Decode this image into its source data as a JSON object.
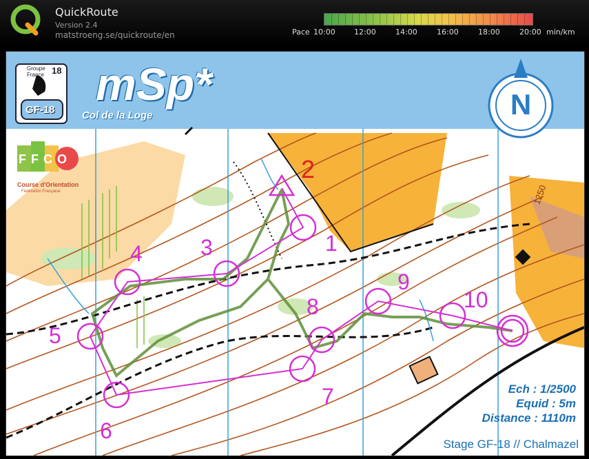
{
  "app": {
    "name": "QuickRoute",
    "version": "Version 2.4",
    "url": "matstroeng.se/quickroute/en"
  },
  "pace": {
    "prefix": "Pace",
    "ticks": [
      "10:00",
      "12:00",
      "14:00",
      "16:00",
      "18:00",
      "20:00"
    ],
    "unit": "min/km",
    "colors": [
      "#4aa64a",
      "#8fc34a",
      "#d8d84a",
      "#f2c24a",
      "#f08a4a",
      "#e84a4a"
    ]
  },
  "map": {
    "title": "mSp*",
    "subtitle": "Col de la Loge",
    "north_letter": "N",
    "logo_badge": {
      "line1": "Groupe",
      "line2": "France",
      "num": "18",
      "short": "GF-18"
    },
    "ffco": {
      "letters": "FFCO",
      "line1": "Course d'Orientation",
      "line2": "Fédération Française"
    },
    "start_number": "2",
    "controls": [
      "1",
      "3",
      "4",
      "5",
      "6",
      "7",
      "8",
      "9",
      "10"
    ],
    "contour_label": "1250",
    "scale": "Ech : 1/2500",
    "equidistance": "Equid : 5m",
    "distance": "Distance : 1110m",
    "footer": "Stage GF-18 // Chalmazel",
    "colors": {
      "header_band": "#8ec3ea",
      "course": "#d42fd4",
      "contour": "#b5561f",
      "open": "#f7b23a",
      "water": "#3aa0d8",
      "info": "#1a6fb4"
    }
  }
}
